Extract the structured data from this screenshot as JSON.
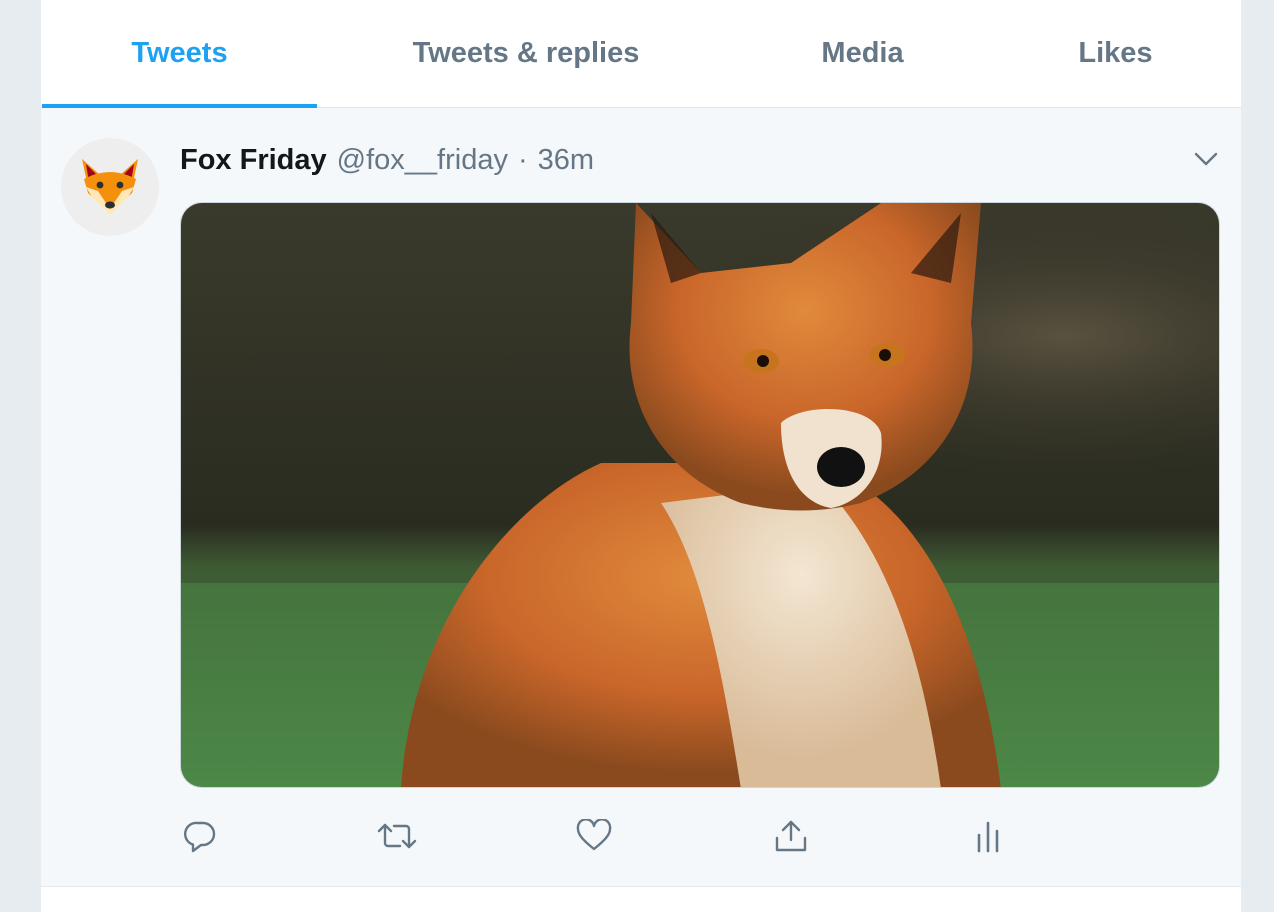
{
  "tabs": [
    {
      "label": "Tweets",
      "active": true
    },
    {
      "label": "Tweets & replies",
      "active": false
    },
    {
      "label": "Media",
      "active": false
    },
    {
      "label": "Likes",
      "active": false
    }
  ],
  "tweet": {
    "display_name": "Fox Friday",
    "handle": "@fox__friday",
    "separator": "·",
    "timestamp": "36m",
    "avatar_icon": "fox-face-icon",
    "media_description_icon": "fox-photo",
    "actions": [
      {
        "icon": "reply-icon"
      },
      {
        "icon": "retweet-icon"
      },
      {
        "icon": "like-icon"
      },
      {
        "icon": "share-icon"
      },
      {
        "icon": "analytics-icon"
      }
    ]
  },
  "colors": {
    "accent": "#1da1f2",
    "secondary_text": "#657786",
    "primary_text": "#14171a",
    "tweet_background": "#f5f8fa",
    "page_background": "#e6ecf0"
  }
}
